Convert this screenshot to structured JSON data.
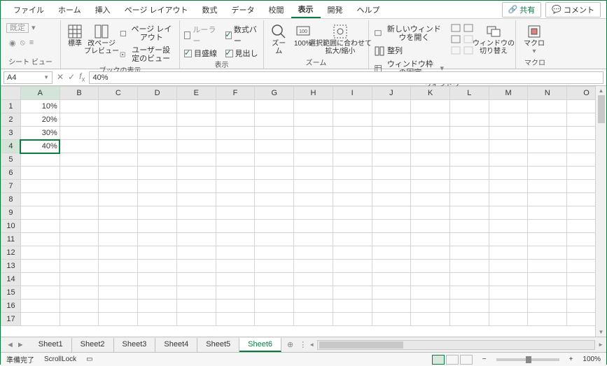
{
  "menu": {
    "tabs": [
      "ファイル",
      "ホーム",
      "挿入",
      "ページ レイアウト",
      "数式",
      "データ",
      "校閲",
      "表示",
      "開発",
      "ヘルプ"
    ],
    "active_index": 7,
    "share": "共有",
    "comment": "コメント"
  },
  "ribbon": {
    "group_sheetview": {
      "label": "シート ビュー",
      "keep": "既定"
    },
    "group_bookview": {
      "label": "ブックの表示",
      "std": "標準",
      "pagebreak": "改ページ\nプレビュー",
      "pagelayout": "ページ レイアウト",
      "customview": "ユーザー設定のビュー"
    },
    "group_show": {
      "label": "表示",
      "ruler": "ルーラー",
      "formulabar": "数式バー",
      "gridlines": "目盛線",
      "headings": "見出し"
    },
    "group_zoom": {
      "label": "ズーム",
      "zoom": "ズーム",
      "hundred": "100%",
      "fitselection": "選択範囲に合わせて\n拡大/縮小"
    },
    "group_window": {
      "label": "ウィンドウ",
      "newwin": "新しいウィンドウを開く",
      "arrange": "整列",
      "freeze": "ウィンドウ枠の固定",
      "switch": "ウィンドウの\n切り替え"
    },
    "group_macro": {
      "label": "マクロ",
      "macro": "マクロ"
    }
  },
  "fx": {
    "name_ref": "A4",
    "formula_value": "40%"
  },
  "grid": {
    "cols": [
      "A",
      "B",
      "C",
      "D",
      "E",
      "F",
      "G",
      "H",
      "I",
      "J",
      "K",
      "L",
      "M",
      "N",
      "O"
    ],
    "rows_count": 17,
    "active": {
      "row": 4,
      "col": "A"
    },
    "data": {
      "A1": "10%",
      "A2": "20%",
      "A3": "30%",
      "A4": "40%"
    }
  },
  "sheets": {
    "tabs": [
      "Sheet1",
      "Sheet2",
      "Sheet3",
      "Sheet4",
      "Sheet5",
      "Sheet6"
    ],
    "active_index": 5
  },
  "status": {
    "ready": "準備完了",
    "scroll": "ScrollLock",
    "zoom": "100%"
  }
}
